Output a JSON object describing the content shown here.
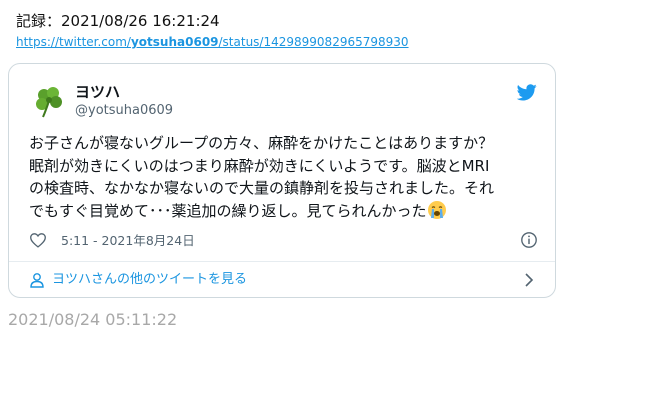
{
  "record": {
    "text": "記録：2021/08/26 16:21:24"
  },
  "source_url": {
    "prefix": "https://twitter.com/",
    "handle": "yotsuha0609",
    "suffix": "/status/1429899082965798930"
  },
  "tweet": {
    "author_name": "ヨツハ",
    "author_handle": "@yotsuha0609",
    "text": "お子さんが寝ないグループの方々、麻酔をかけたことはありますか？\n眠剤が効きにくいのはつまり麻酔が効きにくいようです。脳波とMRI\nの検査時、なかなか寝ないので大量の鎮静剤を投与されました。それ\nでもすぐ目覚めて･･･薬追加の繰り返し。見てられんかった",
    "emoji": "loudly-crying-face",
    "timestamp": "5:11 - 2021年8月24日",
    "more_tweets_label": "ヨツハさんの他のツイートを見る"
  },
  "bottom_time": "2021/08/24 05:11:22",
  "colors": {
    "link": "#1b95e0",
    "twitter_blue": "#1d9bf0",
    "border": "#cfd9de",
    "muted": "#536471",
    "bottom_time": "#a8a8a8"
  }
}
